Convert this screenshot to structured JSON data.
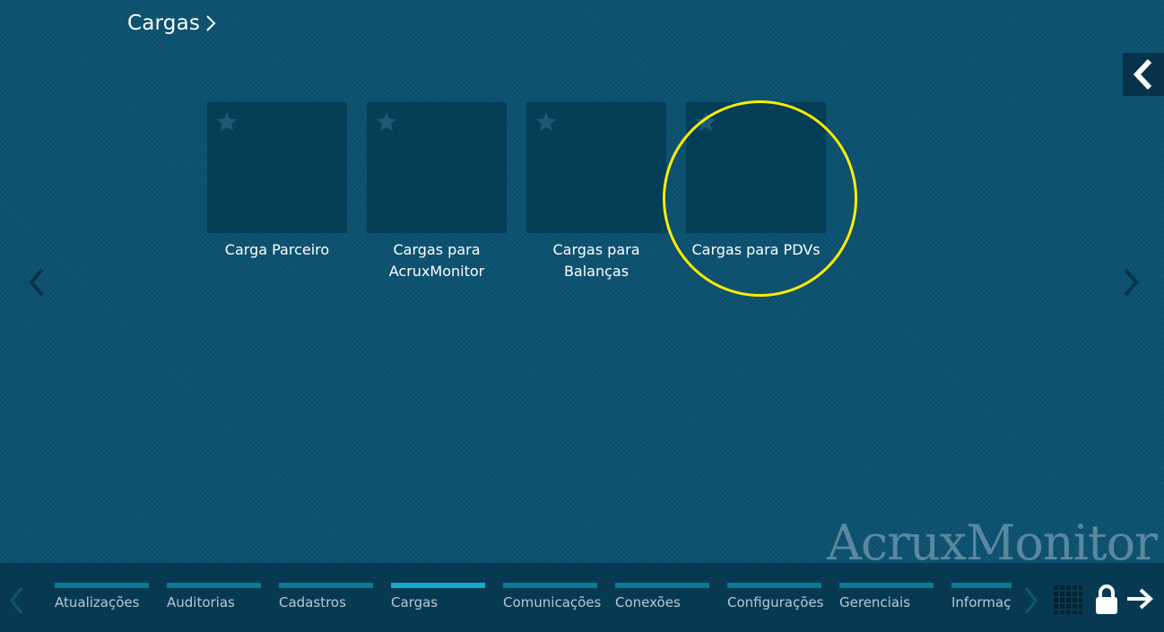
{
  "header": {
    "title": "Cargas"
  },
  "tiles": [
    {
      "label": "Carga Parceiro"
    },
    {
      "label": "Cargas para AcruxMonitor"
    },
    {
      "label": "Cargas para Balanças"
    },
    {
      "label": "Cargas para PDVs"
    }
  ],
  "watermark": "AcruxMonitor",
  "taskbar": {
    "tabs": [
      {
        "label": "Atualizações"
      },
      {
        "label": "Auditorias"
      },
      {
        "label": "Cadastros"
      },
      {
        "label": "Cargas"
      },
      {
        "label": "Comunicações"
      },
      {
        "label": "Conexões"
      },
      {
        "label": "Configurações"
      },
      {
        "label": "Gerenciais"
      },
      {
        "label": "Informações"
      }
    ],
    "active_tab": "Cargas"
  },
  "icons": {
    "header_chevron": "chevron-right-icon",
    "back": "chevron-left-icon",
    "tile_star": "star-icon",
    "nav_left": "chevron-left-icon",
    "nav_right": "chevron-right-icon",
    "apps": "grid-icon",
    "lock": "lock-icon",
    "logout": "arrow-right-icon"
  },
  "colors": {
    "background": "#0b5170",
    "tile": "#043e57",
    "taskbar": "#073a52",
    "tab_bar": "#0a7996",
    "tab_bar_active": "#16a8cc",
    "highlight": "#ffee00"
  }
}
